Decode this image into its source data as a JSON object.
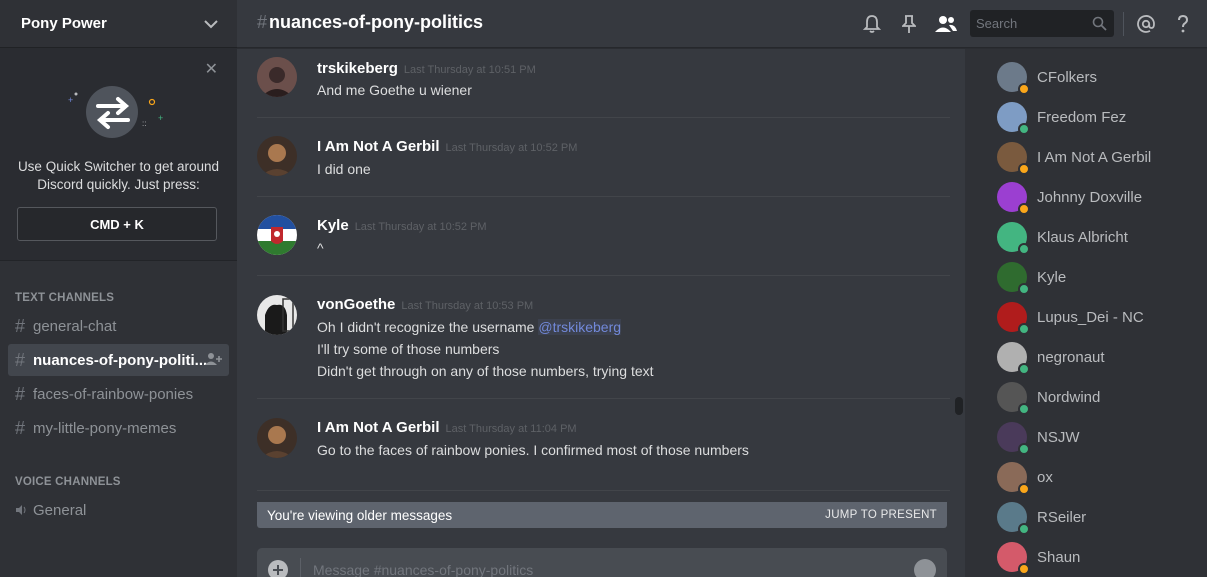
{
  "server": {
    "name": "Pony Power"
  },
  "tip": {
    "text": "Use Quick Switcher to get around Discord quickly. Just press:",
    "shortcut": "CMD + K"
  },
  "categories": {
    "text": "TEXT CHANNELS",
    "voice": "VOICE CHANNELS"
  },
  "text_channels": [
    {
      "name": "general-chat"
    },
    {
      "name": "nuances-of-pony-politi..."
    },
    {
      "name": "faces-of-rainbow-ponies"
    },
    {
      "name": "my-little-pony-memes"
    }
  ],
  "voice_channels": [
    {
      "name": "General"
    }
  ],
  "header": {
    "hash": "#",
    "channel": "nuances-of-pony-politics",
    "search_placeholder": "Search",
    "icons": [
      "bell-icon",
      "pin-icon",
      "members-icon",
      "search-icon",
      "at-icon",
      "help-icon"
    ]
  },
  "messages": [
    {
      "author": "trskikeberg",
      "time": "Last Thursday at 10:51 PM",
      "lines": [
        "And me Goethe u wiener"
      ],
      "avatar_color": "#5a4a48"
    },
    {
      "author": "I Am Not A Gerbil",
      "time": "Last Thursday at 10:52 PM",
      "lines": [
        "I did one"
      ],
      "avatar_color": "#7a5a3e"
    },
    {
      "author": "Kyle",
      "time": "Last Thursday at 10:52 PM",
      "lines": [
        "^"
      ],
      "avatar_color": "#2f6b2f"
    },
    {
      "author": "vonGoethe",
      "time": "Last Thursday at 10:53 PM",
      "lines_pre": "Oh I didn't recognize the username ",
      "mention": "@trskikeberg",
      "lines": [
        "I'll try some of those numbers",
        "Didn't get through on any of those numbers, trying text"
      ],
      "avatar_color": "#ddd"
    },
    {
      "author": "I Am Not A Gerbil",
      "time": "Last Thursday at 11:04 PM",
      "lines": [
        "Go to the faces of rainbow ponies. I confirmed most of those numbers"
      ],
      "avatar_color": "#7a5a3e"
    }
  ],
  "older_bar": {
    "text": "You're viewing older messages",
    "jump": "JUMP TO PRESENT"
  },
  "composer": {
    "placeholder": "Message #nuances-of-pony-politics"
  },
  "members": [
    {
      "name": "CFolkers",
      "status": "idle",
      "color": "#6c7a8a"
    },
    {
      "name": "Freedom Fez",
      "status": "online",
      "color": "#7e9cc4"
    },
    {
      "name": "I Am Not A Gerbil",
      "status": "idle",
      "color": "#7a5a3e"
    },
    {
      "name": "Johnny Doxville",
      "status": "idle",
      "color": "#9b3fd1"
    },
    {
      "name": "Klaus Albricht",
      "status": "online",
      "color": "#43b581"
    },
    {
      "name": "Kyle",
      "status": "online",
      "color": "#2f6b2f"
    },
    {
      "name": "Lupus_Dei - NC",
      "status": "online",
      "color": "#b01c1c"
    },
    {
      "name": "negronaut",
      "status": "online",
      "color": "#b0b0b0"
    },
    {
      "name": "Nordwind",
      "status": "online",
      "color": "#555"
    },
    {
      "name": "NSJW",
      "status": "online",
      "color": "#4a3a5a"
    },
    {
      "name": "ox",
      "status": "idle",
      "color": "#8a6a58"
    },
    {
      "name": "RSeiler",
      "status": "online",
      "color": "#5a7a8a"
    },
    {
      "name": "Shaun",
      "status": "idle",
      "color": "#d45a6a"
    }
  ],
  "colors": {
    "online": "#43b581",
    "idle": "#faa61a",
    "accent": "#7289da"
  }
}
